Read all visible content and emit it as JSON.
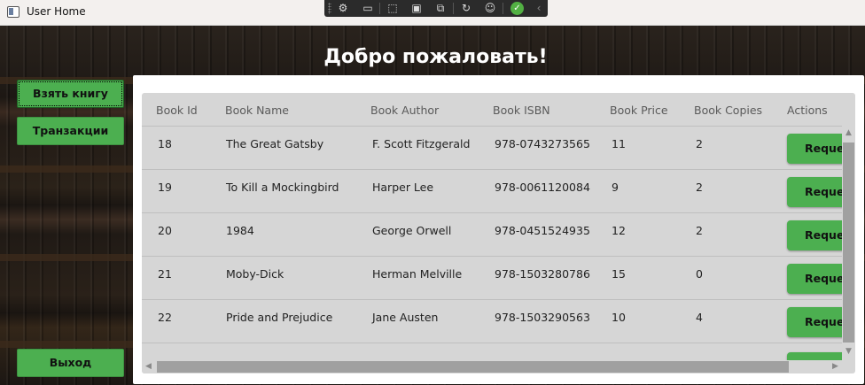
{
  "window": {
    "title": "User Home"
  },
  "header": {
    "welcome": "Добро пожаловать!"
  },
  "sidebar": {
    "take_book": "Взять книгу",
    "transactions": "Транзакции",
    "exit": "Выход"
  },
  "table": {
    "columns": [
      "Book Id",
      "Book Name",
      "Book Author",
      "Book ISBN",
      "Book Price",
      "Book Copies",
      "Actions"
    ],
    "action_label": "Request",
    "rows": [
      {
        "id": "18",
        "name": "The Great Gatsby",
        "author": "F. Scott Fitzgerald",
        "isbn": "978-0743273565",
        "price": "11",
        "copies": "2"
      },
      {
        "id": "19",
        "name": "To Kill a Mockingbird",
        "author": "Harper Lee",
        "isbn": "978-0061120084",
        "price": "9",
        "copies": "2"
      },
      {
        "id": "20",
        "name": "1984",
        "author": "George Orwell",
        "isbn": "978-0451524935",
        "price": "12",
        "copies": "2"
      },
      {
        "id": "21",
        "name": "Moby-Dick",
        "author": "Herman Melville",
        "isbn": "978-1503280786",
        "price": "15",
        "copies": "0"
      },
      {
        "id": "22",
        "name": "Pride and Prejudice",
        "author": "Jane Austen",
        "isbn": "978-1503290563",
        "price": "10",
        "copies": "4"
      }
    ]
  },
  "colors": {
    "accent": "#4caf50",
    "panel": "#ffffff",
    "grid": "#d6d6d6"
  }
}
